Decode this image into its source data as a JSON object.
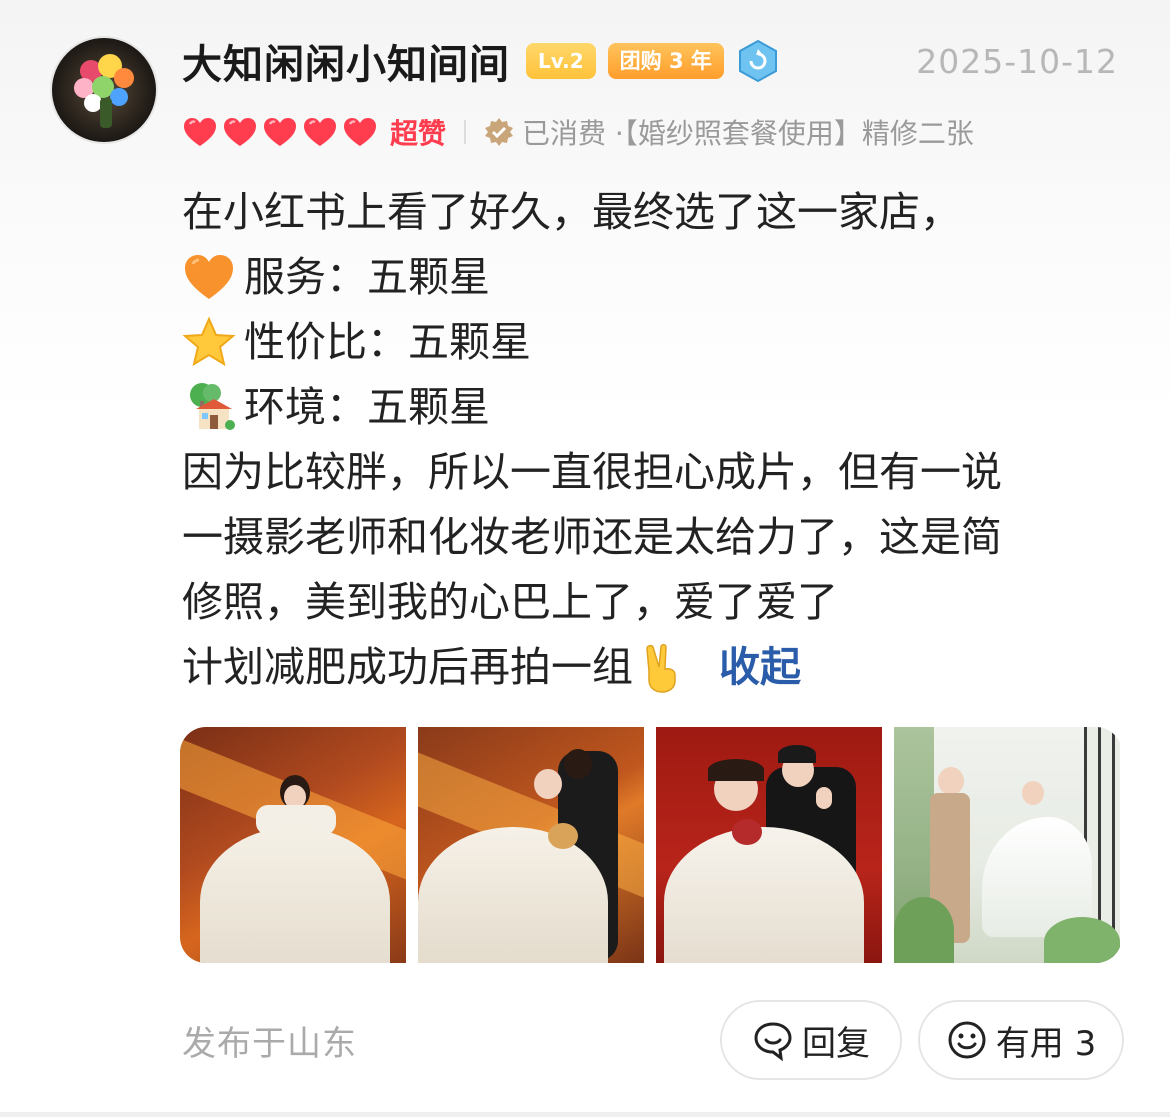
{
  "user": {
    "name": "大知闲闲小知间间",
    "level_badge": "Lv.2",
    "tuangou_badge": "团购 3 年",
    "date": "2025-10-12"
  },
  "rating": {
    "hearts": 5,
    "label": "超赞",
    "consumed_text": "已消费 ·【婚纱照套餐使用】精修二张"
  },
  "review": {
    "line1": "在小红书上看了好久，最终选了这一家店，",
    "service": "服务：五颗星",
    "value": "性价比：五颗星",
    "environment": "环境：五颗星",
    "line5": "因为比较胖，所以一直很担心成片，但有一说",
    "line6": "一摄影老师和化妆老师还是太给力了，这是简",
    "line7": "修照，美到我的心巴上了，爱了爱了",
    "line8": "计划减肥成功后再拍一组",
    "collapse": "收起"
  },
  "photos": [
    "bride-sunlight",
    "couple-sunlight",
    "couple-red",
    "couple-garden"
  ],
  "footer": {
    "location": "发布于山东",
    "reply_label": "回复",
    "useful_label": "有用 3"
  },
  "colors": {
    "accent_red": "#ff3d4f",
    "link_blue": "#2a5caa",
    "muted": "#9a9a9a"
  },
  "icons": {
    "service": "orange-heart-icon",
    "value": "star-icon",
    "environment": "house-with-garden-icon",
    "peace": "victory-hand-icon",
    "reply": "speech-bubble-icon",
    "useful": "smile-face-icon"
  }
}
